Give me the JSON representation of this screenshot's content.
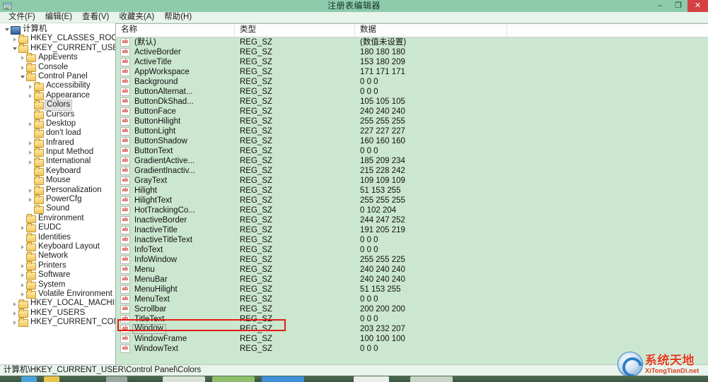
{
  "window": {
    "title": "注册表编辑器",
    "icon": "registry-editor-icon",
    "controls": {
      "minimize": "–",
      "restore": "❐",
      "close": "✕"
    },
    "close_color": "#d44141",
    "titlebar_color": "#8ecbad"
  },
  "menubar": {
    "items": [
      {
        "label": "文件(F)"
      },
      {
        "label": "编辑(E)"
      },
      {
        "label": "查看(V)"
      },
      {
        "label": "收藏夹(A)"
      },
      {
        "label": "帮助(H)"
      }
    ]
  },
  "tree": {
    "nodes": [
      {
        "label": "计算机",
        "depth": 0,
        "twist": "expanded",
        "icon": "computer-icon",
        "selected": false
      },
      {
        "label": "HKEY_CLASSES_ROOT",
        "depth": 1,
        "twist": "collapsed",
        "icon": "folder-icon",
        "selected": false
      },
      {
        "label": "HKEY_CURRENT_USER",
        "depth": 1,
        "twist": "expanded",
        "icon": "folder-icon",
        "selected": false
      },
      {
        "label": "AppEvents",
        "depth": 2,
        "twist": "collapsed",
        "icon": "folder-icon",
        "selected": false
      },
      {
        "label": "Console",
        "depth": 2,
        "twist": "collapsed",
        "icon": "folder-icon",
        "selected": false
      },
      {
        "label": "Control Panel",
        "depth": 2,
        "twist": "expanded",
        "icon": "folder-icon",
        "selected": false
      },
      {
        "label": "Accessibility",
        "depth": 3,
        "twist": "collapsed",
        "icon": "folder-icon",
        "selected": false
      },
      {
        "label": "Appearance",
        "depth": 3,
        "twist": "collapsed",
        "icon": "folder-icon",
        "selected": false
      },
      {
        "label": "Colors",
        "depth": 3,
        "twist": "none",
        "icon": "folder-icon",
        "selected": true
      },
      {
        "label": "Cursors",
        "depth": 3,
        "twist": "none",
        "icon": "folder-icon",
        "selected": false
      },
      {
        "label": "Desktop",
        "depth": 3,
        "twist": "collapsed",
        "icon": "folder-icon",
        "selected": false
      },
      {
        "label": "don't load",
        "depth": 3,
        "twist": "none",
        "icon": "folder-icon",
        "selected": false
      },
      {
        "label": "Infrared",
        "depth": 3,
        "twist": "collapsed",
        "icon": "folder-icon",
        "selected": false
      },
      {
        "label": "Input Method",
        "depth": 3,
        "twist": "collapsed",
        "icon": "folder-icon",
        "selected": false
      },
      {
        "label": "International",
        "depth": 3,
        "twist": "collapsed",
        "icon": "folder-icon",
        "selected": false
      },
      {
        "label": "Keyboard",
        "depth": 3,
        "twist": "none",
        "icon": "folder-icon",
        "selected": false
      },
      {
        "label": "Mouse",
        "depth": 3,
        "twist": "none",
        "icon": "folder-icon",
        "selected": false
      },
      {
        "label": "Personalization",
        "depth": 3,
        "twist": "collapsed",
        "icon": "folder-icon",
        "selected": false
      },
      {
        "label": "PowerCfg",
        "depth": 3,
        "twist": "collapsed",
        "icon": "folder-icon",
        "selected": false
      },
      {
        "label": "Sound",
        "depth": 3,
        "twist": "none",
        "icon": "folder-icon",
        "selected": false
      },
      {
        "label": "Environment",
        "depth": 2,
        "twist": "none",
        "icon": "folder-icon",
        "selected": false
      },
      {
        "label": "EUDC",
        "depth": 2,
        "twist": "collapsed",
        "icon": "folder-icon",
        "selected": false
      },
      {
        "label": "Identities",
        "depth": 2,
        "twist": "none",
        "icon": "folder-icon",
        "selected": false
      },
      {
        "label": "Keyboard Layout",
        "depth": 2,
        "twist": "collapsed",
        "icon": "folder-icon",
        "selected": false
      },
      {
        "label": "Network",
        "depth": 2,
        "twist": "none",
        "icon": "folder-icon",
        "selected": false
      },
      {
        "label": "Printers",
        "depth": 2,
        "twist": "collapsed",
        "icon": "folder-icon",
        "selected": false
      },
      {
        "label": "Software",
        "depth": 2,
        "twist": "collapsed",
        "icon": "folder-icon",
        "selected": false
      },
      {
        "label": "System",
        "depth": 2,
        "twist": "collapsed",
        "icon": "folder-icon",
        "selected": false
      },
      {
        "label": "Volatile Environment",
        "depth": 2,
        "twist": "collapsed",
        "icon": "folder-icon",
        "selected": false
      },
      {
        "label": "HKEY_LOCAL_MACHINE",
        "depth": 1,
        "twist": "collapsed",
        "icon": "folder-icon",
        "selected": false
      },
      {
        "label": "HKEY_USERS",
        "depth": 1,
        "twist": "collapsed",
        "icon": "folder-icon",
        "selected": false
      },
      {
        "label": "HKEY_CURRENT_CONFIG",
        "depth": 1,
        "twist": "collapsed",
        "icon": "folder-icon",
        "selected": false
      }
    ]
  },
  "list": {
    "columns": [
      "名称",
      "类型",
      "数据",
      ""
    ],
    "rows": [
      {
        "name": "(默认)",
        "type": "REG_SZ",
        "data": "(数值未设置)",
        "highlighted": false
      },
      {
        "name": "ActiveBorder",
        "type": "REG_SZ",
        "data": "180 180 180",
        "highlighted": false
      },
      {
        "name": "ActiveTitle",
        "type": "REG_SZ",
        "data": "153 180 209",
        "highlighted": false
      },
      {
        "name": "AppWorkspace",
        "type": "REG_SZ",
        "data": "171 171 171",
        "highlighted": false
      },
      {
        "name": "Background",
        "type": "REG_SZ",
        "data": "0 0 0",
        "highlighted": false
      },
      {
        "name": "ButtonAlternat...",
        "type": "REG_SZ",
        "data": "0 0 0",
        "highlighted": false
      },
      {
        "name": "ButtonDkShad...",
        "type": "REG_SZ",
        "data": "105 105 105",
        "highlighted": false
      },
      {
        "name": "ButtonFace",
        "type": "REG_SZ",
        "data": "240 240 240",
        "highlighted": false
      },
      {
        "name": "ButtonHilight",
        "type": "REG_SZ",
        "data": "255 255 255",
        "highlighted": false
      },
      {
        "name": "ButtonLight",
        "type": "REG_SZ",
        "data": "227 227 227",
        "highlighted": false
      },
      {
        "name": "ButtonShadow",
        "type": "REG_SZ",
        "data": "160 160 160",
        "highlighted": false
      },
      {
        "name": "ButtonText",
        "type": "REG_SZ",
        "data": "0 0 0",
        "highlighted": false
      },
      {
        "name": "GradientActive...",
        "type": "REG_SZ",
        "data": "185 209 234",
        "highlighted": false
      },
      {
        "name": "GradientInactiv...",
        "type": "REG_SZ",
        "data": "215 228 242",
        "highlighted": false
      },
      {
        "name": "GrayText",
        "type": "REG_SZ",
        "data": "109 109 109",
        "highlighted": false
      },
      {
        "name": "Hilight",
        "type": "REG_SZ",
        "data": "51 153 255",
        "highlighted": false
      },
      {
        "name": "HilightText",
        "type": "REG_SZ",
        "data": "255 255 255",
        "highlighted": false
      },
      {
        "name": "HotTrackingCo...",
        "type": "REG_SZ",
        "data": "0 102 204",
        "highlighted": false
      },
      {
        "name": "InactiveBorder",
        "type": "REG_SZ",
        "data": "244 247 252",
        "highlighted": false
      },
      {
        "name": "InactiveTitle",
        "type": "REG_SZ",
        "data": "191 205 219",
        "highlighted": false
      },
      {
        "name": "InactiveTitleText",
        "type": "REG_SZ",
        "data": "0 0 0",
        "highlighted": false
      },
      {
        "name": "InfoText",
        "type": "REG_SZ",
        "data": "0 0 0",
        "highlighted": false
      },
      {
        "name": "InfoWindow",
        "type": "REG_SZ",
        "data": "255 255 225",
        "highlighted": false
      },
      {
        "name": "Menu",
        "type": "REG_SZ",
        "data": "240 240 240",
        "highlighted": false
      },
      {
        "name": "MenuBar",
        "type": "REG_SZ",
        "data": "240 240 240",
        "highlighted": false
      },
      {
        "name": "MenuHilight",
        "type": "REG_SZ",
        "data": "51 153 255",
        "highlighted": false
      },
      {
        "name": "MenuText",
        "type": "REG_SZ",
        "data": "0 0 0",
        "highlighted": false
      },
      {
        "name": "Scrollbar",
        "type": "REG_SZ",
        "data": "200 200 200",
        "highlighted": false
      },
      {
        "name": "TitleText",
        "type": "REG_SZ",
        "data": "0 0 0",
        "highlighted": false
      },
      {
        "name": "Window",
        "type": "REG_SZ",
        "data": "203 232 207",
        "highlighted": true
      },
      {
        "name": "WindowFrame",
        "type": "REG_SZ",
        "data": "100 100 100",
        "highlighted": false
      },
      {
        "name": "WindowText",
        "type": "REG_SZ",
        "data": "0 0 0",
        "highlighted": false
      }
    ],
    "background_color": "#cbe7cf",
    "annotation_color": "#e51b12"
  },
  "statusbar": {
    "path": "计算机\\HKEY_CURRENT_USER\\Control Panel\\Colors"
  },
  "watermark": {
    "cn": "系统天地",
    "en": "XiTongTianDi.net",
    "color": "#e03a1c"
  }
}
